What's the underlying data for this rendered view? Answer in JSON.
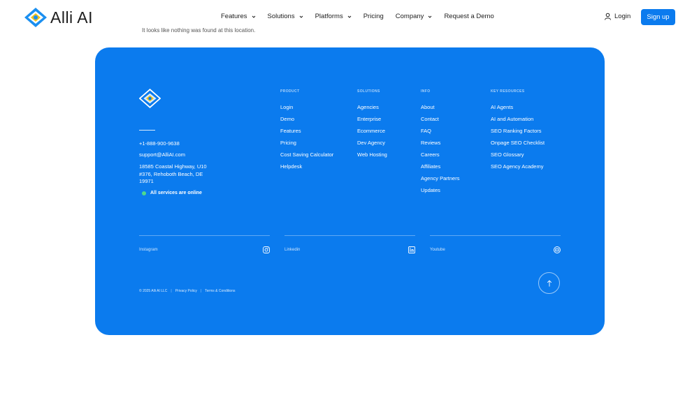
{
  "header": {
    "brand": "Alli AI",
    "nav": [
      {
        "label": "Features",
        "dropdown": true
      },
      {
        "label": "Solutions",
        "dropdown": true
      },
      {
        "label": "Platforms",
        "dropdown": true
      },
      {
        "label": "Pricing",
        "dropdown": false
      },
      {
        "label": "Company",
        "dropdown": true
      },
      {
        "label": "Request a Demo",
        "dropdown": false
      }
    ],
    "login_label": "Login",
    "signup_label": "Sign up"
  },
  "main": {
    "not_found_text": "It looks like nothing was found at this location."
  },
  "footer": {
    "phone": "+1-888-900-9638",
    "email": "support@AlliAI.com",
    "address": "18585 Coastal Highway, U10 #376, Rehoboth Beach, DE 19971",
    "status": "All services are online",
    "columns": {
      "product": {
        "heading": "PRODUCT",
        "items": [
          "Login",
          "Demo",
          "Features",
          "Pricing",
          "Cost Saving Calculator",
          "Helpdesk"
        ]
      },
      "solutions": {
        "heading": "SOLUTIONS",
        "items": [
          "Agencies",
          "Enterprise",
          "Ecommerce",
          "Dev Agency",
          "Web Hosting"
        ]
      },
      "info": {
        "heading": "INFO",
        "items": [
          "About",
          "Contact",
          "FAQ",
          "Reviews",
          "Careers",
          "Affiliates",
          "Agency Partners",
          "Updates"
        ]
      },
      "key_resources": {
        "heading": "KEY RESOURCES",
        "items": [
          "AI Agents",
          "AI and Automation",
          "SEO Ranking Factors",
          "Onpage SEO Checklist",
          "SEO Glossary",
          "SEO Agency Academy"
        ]
      }
    },
    "social": [
      {
        "label": "Instagram",
        "icon": "instagram-icon"
      },
      {
        "label": "Linkedin",
        "icon": "linkedin-icon"
      },
      {
        "label": "Youtube",
        "icon": "youtube-icon"
      }
    ],
    "copyright": "© 2025 Alli AI LLC",
    "privacy_label": "Privacy Policy",
    "terms_label": "Terms & Conditions"
  },
  "colors": {
    "brand_blue": "#0b7bee",
    "status_green": "#4ed98d"
  }
}
